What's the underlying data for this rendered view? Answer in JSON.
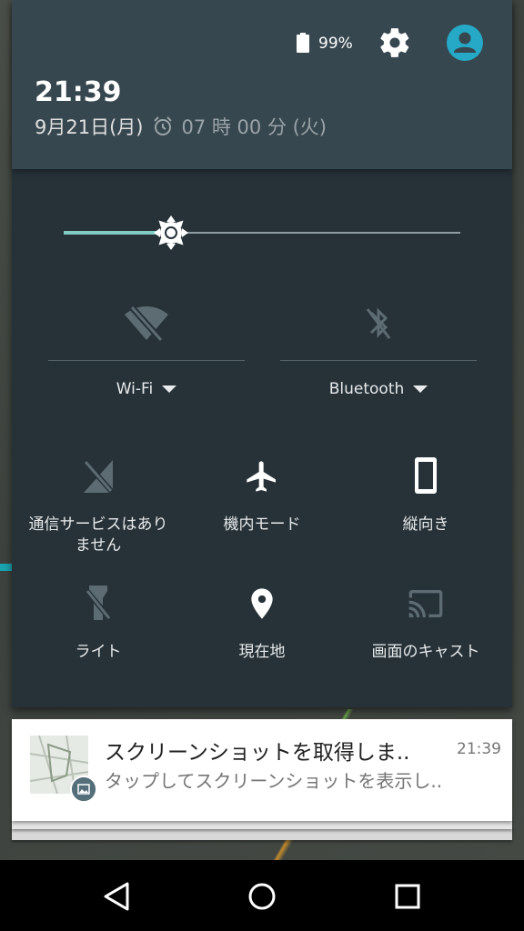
{
  "status": {
    "battery_percent": "99%"
  },
  "header": {
    "time": "21:39",
    "date": "9月21日(月)",
    "alarm": "07 時 00 分 (火)"
  },
  "brightness": {
    "level": 0.27
  },
  "wifi": {
    "label": "Wi-Fi",
    "icon": "wifi-off-icon"
  },
  "bluetooth": {
    "label": "Bluetooth",
    "icon": "bluetooth-off-icon"
  },
  "tiles": [
    {
      "label": "通信サービスはありません",
      "icon": "signal-off-icon"
    },
    {
      "label": "機内モード",
      "icon": "airplane-icon"
    },
    {
      "label": "縦向き",
      "icon": "portrait-icon"
    },
    {
      "label": "ライト",
      "icon": "flashlight-off-icon"
    },
    {
      "label": "現在地",
      "icon": "location-icon"
    },
    {
      "label": "画面のキャスト",
      "icon": "cast-icon"
    }
  ],
  "notification": {
    "title": "スクリーンショットを取得しま..",
    "time": "21:39",
    "body": "タップしてスクリーンショットを表示し.."
  },
  "colors": {
    "accent": "#80cbc4",
    "avatar": "#26a9c6",
    "shade": "#263238",
    "header": "#37474f"
  }
}
